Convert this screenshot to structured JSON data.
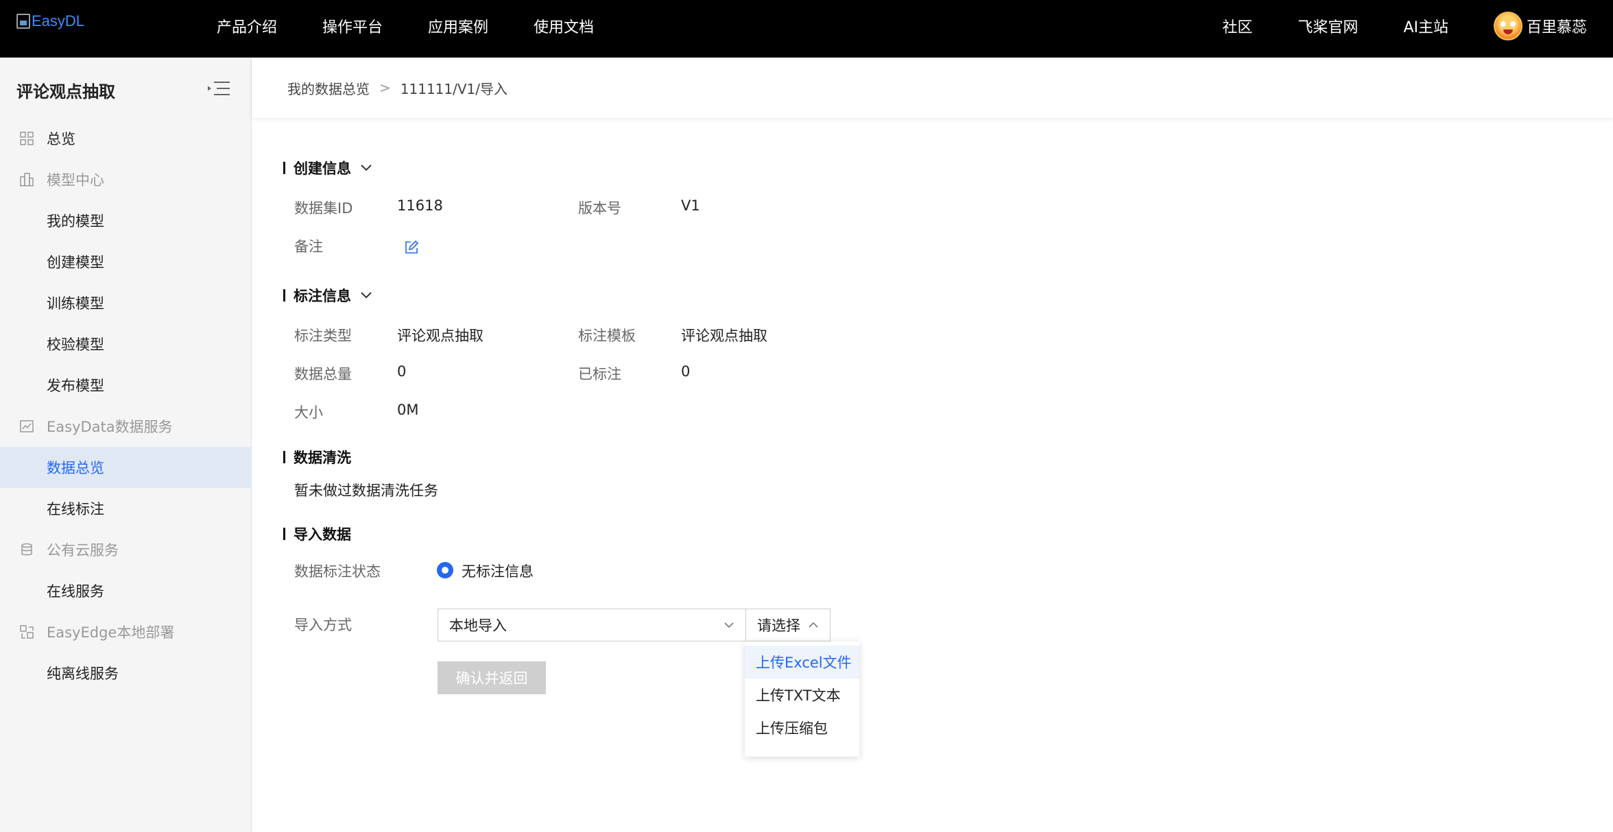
{
  "header": {
    "logo_text": "EasyDL",
    "nav_left": [
      "产品介绍",
      "操作平台",
      "应用案例",
      "使用文档"
    ],
    "nav_right": [
      "社区",
      "飞桨官网",
      "AI主站"
    ],
    "user_name": "百里慕蕊"
  },
  "sidebar": {
    "title": "评论观点抽取",
    "items": [
      {
        "label": "总览",
        "icon": "grid-icon"
      },
      {
        "label": "模型中心",
        "icon": "building-icon"
      },
      {
        "label": "我的模型"
      },
      {
        "label": "创建模型"
      },
      {
        "label": "训练模型"
      },
      {
        "label": "校验模型"
      },
      {
        "label": "发布模型"
      },
      {
        "label": "EasyData数据服务",
        "icon": "chart-icon"
      },
      {
        "label": "数据总览",
        "active": true
      },
      {
        "label": "在线标注"
      },
      {
        "label": "公有云服务",
        "icon": "database-icon"
      },
      {
        "label": "在线服务"
      },
      {
        "label": "EasyEdge本地部署",
        "icon": "deploy-icon"
      },
      {
        "label": "纯离线服务"
      }
    ]
  },
  "breadcrumb": {
    "parent": "我的数据总览",
    "separator": ">",
    "current": "111111/V1/导入"
  },
  "create_info": {
    "title": "创建信息",
    "dataset_id_label": "数据集ID",
    "dataset_id_value": "11618",
    "version_label": "版本号",
    "version_value": "V1",
    "remark_label": "备注"
  },
  "annotation_info": {
    "title": "标注信息",
    "type_label": "标注类型",
    "type_value": "评论观点抽取",
    "template_label": "标注模板",
    "template_value": "评论观点抽取",
    "total_label": "数据总量",
    "total_value": "0",
    "labeled_label": "已标注",
    "labeled_value": "0",
    "size_label": "大小",
    "size_value": "0M"
  },
  "data_cleaning": {
    "title": "数据清洗",
    "message": "暂未做过数据清洗任务"
  },
  "import_data": {
    "title": "导入数据",
    "status_label": "数据标注状态",
    "status_option": "无标注信息",
    "method_label": "导入方式",
    "method_value": "本地导入",
    "sub_placeholder": "请选择",
    "dropdown_options": [
      "上传Excel文件",
      "上传TXT文本",
      "上传压缩包"
    ],
    "confirm_label": "确认并返回"
  },
  "colors": {
    "accent": "#2468f2",
    "topbar_bg": "#000000",
    "sidebar_bg": "#f5f5f5",
    "active_bg": "#e0e8f4"
  }
}
